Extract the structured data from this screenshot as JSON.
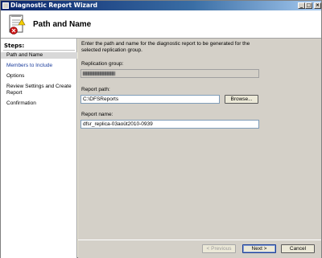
{
  "window": {
    "title": "Diagnostic Report Wizard"
  },
  "titlebar_buttons": {
    "minimize": "_",
    "maximize": "□",
    "close": "×"
  },
  "header": {
    "title": "Path and Name",
    "icon": "report-wizard-icon"
  },
  "sidebar": {
    "heading": "Steps:",
    "items": [
      {
        "label": "Path and Name",
        "state": "current"
      },
      {
        "label": "Members to Include",
        "state": "link"
      },
      {
        "label": "Options",
        "state": "normal"
      },
      {
        "label": "Review Settings and Create Report",
        "state": "normal"
      },
      {
        "label": "Confirmation",
        "state": "normal"
      }
    ]
  },
  "main": {
    "instructions": "Enter the path and name for the diagnostic report to be generated for the selected replication group.",
    "replication_group": {
      "label": "Replication group:",
      "value": ""
    },
    "report_path": {
      "label": "Report path:",
      "value": "C:\\DFSReports"
    },
    "browse_label": "Browse...",
    "report_name": {
      "label": "Report name:",
      "value": "dfsr_replica-03août2010-0939"
    }
  },
  "footer": {
    "previous_label": "< Previous",
    "next_label": "Next >",
    "cancel_label": "Cancel"
  },
  "colors": {
    "titlebar_start": "#0a246a",
    "titlebar_end": "#a6caf0",
    "dialog_bg": "#d4d0c8",
    "link": "#1a3c9c"
  }
}
